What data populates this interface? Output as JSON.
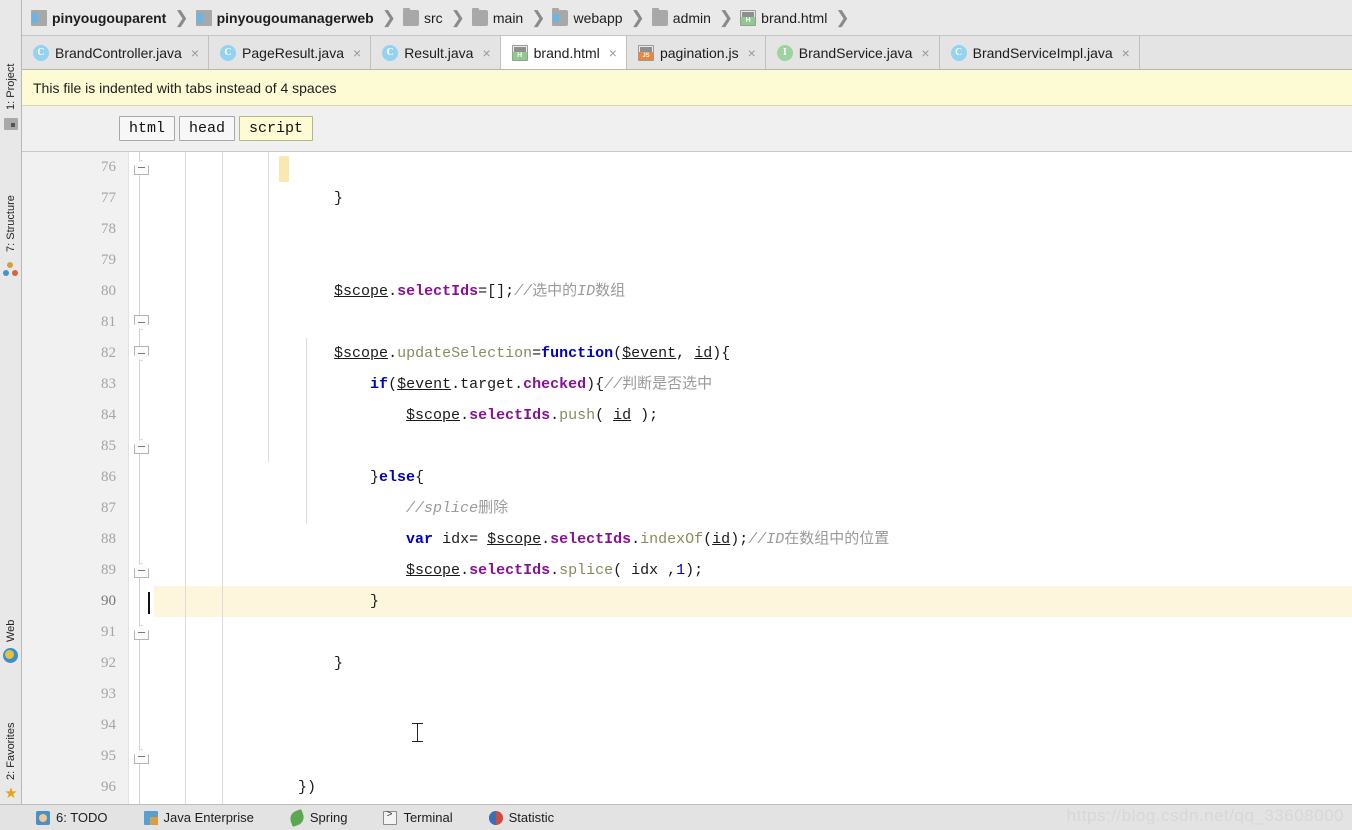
{
  "breadcrumb": {
    "items": [
      {
        "label": "pinyougouparent",
        "icon": "module-icon",
        "bold": true
      },
      {
        "label": "pinyougoumanagerweb",
        "icon": "module-icon",
        "bold": true
      },
      {
        "label": "src",
        "icon": "folder-icon",
        "bold": false
      },
      {
        "label": "main",
        "icon": "folder-icon",
        "bold": false
      },
      {
        "label": "webapp",
        "icon": "folder-web-icon",
        "bold": false
      },
      {
        "label": "admin",
        "icon": "folder-icon",
        "bold": false
      },
      {
        "label": "brand.html",
        "icon": "html-file-icon",
        "bold": false
      }
    ],
    "separator": "❯"
  },
  "editor_tabs": [
    {
      "label": "BrandController.java",
      "icon": "java-class-icon",
      "active": false,
      "close": "×"
    },
    {
      "label": "PageResult.java",
      "icon": "java-class-icon",
      "active": false,
      "close": "×"
    },
    {
      "label": "Result.java",
      "icon": "java-class-icon",
      "active": false,
      "close": "×"
    },
    {
      "label": "brand.html",
      "icon": "html-file-icon",
      "active": true,
      "close": "×"
    },
    {
      "label": "pagination.js",
      "icon": "js-file-icon",
      "active": false,
      "close": "×"
    },
    {
      "label": "BrandService.java",
      "icon": "java-interface-icon",
      "active": false,
      "close": "×"
    },
    {
      "label": "BrandServiceImpl.java",
      "icon": "java-class-icon",
      "active": false,
      "close": "×"
    }
  ],
  "notification": {
    "message": "This file is indented with tabs instead of 4 spaces"
  },
  "structure_chips": [
    {
      "label": "html",
      "selected": false
    },
    {
      "label": "head",
      "selected": false
    },
    {
      "label": "script",
      "selected": true
    }
  ],
  "left_tool_buttons": [
    {
      "label": "1: Project",
      "icon": "project-icon"
    },
    {
      "label": "7: Structure",
      "icon": "structure-icon"
    }
  ],
  "left_tool_buttons_bottom": [
    {
      "label": "Web",
      "icon": "web-icon"
    },
    {
      "label": "2: Favorites",
      "icon": "star-icon"
    }
  ],
  "code": {
    "first_line_number": 76,
    "last_line_number": 96,
    "current_line": 90,
    "lines": [
      {
        "n": 76,
        "text": "\t\t\t}"
      },
      {
        "n": 77,
        "text": ""
      },
      {
        "n": 78,
        "text": ""
      },
      {
        "n": 79,
        "text": "\t\t\t$scope.selectIds=[];//选中的ID数组"
      },
      {
        "n": 80,
        "text": ""
      },
      {
        "n": 81,
        "text": "\t\t\t$scope.updateSelection=function($event, id){"
      },
      {
        "n": 82,
        "text": "\t\t\t\tif($event.target.checked){//判断是否选中"
      },
      {
        "n": 83,
        "text": "\t\t\t\t\t$scope.selectIds.push( id );"
      },
      {
        "n": 84,
        "text": ""
      },
      {
        "n": 85,
        "text": "\t\t\t\t}else{"
      },
      {
        "n": 86,
        "text": "\t\t\t\t\t//splice删除"
      },
      {
        "n": 87,
        "text": "\t\t\t\t\tvar idx= $scope.selectIds.indexOf(id);//ID在数组中的位置"
      },
      {
        "n": 88,
        "text": "\t\t\t\t\t$scope.selectIds.splice( idx ,1);"
      },
      {
        "n": 89,
        "text": "\t\t\t\t}"
      },
      {
        "n": 90,
        "text": ""
      },
      {
        "n": 91,
        "text": "\t\t\t}"
      },
      {
        "n": 92,
        "text": ""
      },
      {
        "n": 93,
        "text": ""
      },
      {
        "n": 94,
        "text": ""
      },
      {
        "n": 95,
        "text": "\t\t})"
      },
      {
        "n": 96,
        "text": ""
      }
    ],
    "fold_markers": [
      {
        "line": 76,
        "type": "up"
      },
      {
        "line": 81,
        "type": "down"
      },
      {
        "line": 82,
        "type": "down"
      },
      {
        "line": 85,
        "type": "up"
      },
      {
        "line": 89,
        "type": "up"
      },
      {
        "line": 91,
        "type": "up"
      },
      {
        "line": 95,
        "type": "up"
      }
    ]
  },
  "status_bar": {
    "items": [
      {
        "label": "6: TODO",
        "underline_char": "6",
        "icon": "todo-icon"
      },
      {
        "label": "Java Enterprise",
        "icon": "java-enterprise-icon"
      },
      {
        "label": "Spring",
        "icon": "spring-leaf-icon"
      },
      {
        "label": "Terminal",
        "icon": "terminal-icon"
      },
      {
        "label": "Statistic",
        "icon": "statistic-icon"
      }
    ]
  },
  "watermark": {
    "text": "https://blog.csdn.net/qq_33608000"
  },
  "colors": {
    "keyword": "#0000c0",
    "field": "#871094",
    "comment": "#9a9a9a",
    "property": "#8a8a60",
    "current_line_highlight": "#fdf6dd",
    "notification_bg": "#fcfbd4",
    "editor_bg": "#ffffff",
    "gutter_bg": "#f1f1f1"
  }
}
